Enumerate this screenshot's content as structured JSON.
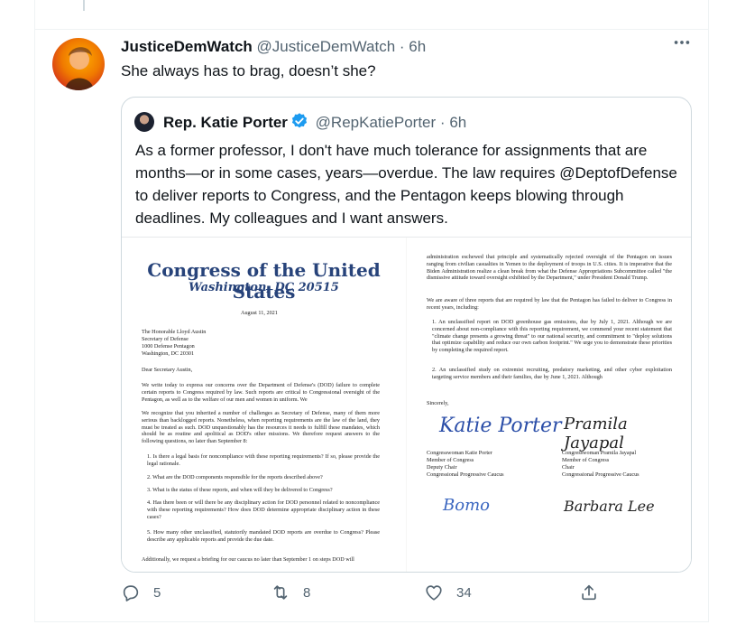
{
  "tweet": {
    "author_name": "JusticeDemWatch",
    "handle": "@JusticeDemWatch",
    "separator": "·",
    "time": "6h",
    "text": "She always has to brag, doesn’t she?",
    "more_icon": "more-horizontal-icon"
  },
  "quote": {
    "author_name": "Rep. Katie Porter",
    "handle": "@RepKatiePorter",
    "separator": "·",
    "time": "6h",
    "verified_icon": "verified-badge-icon",
    "verified_color": "#1d9bf0",
    "text": "As a former professor, I don't have much tolerance for assignments that are months—or in some cases, years—overdue. The law requires @DeptofDefense to deliver reports to Congress, and the Pentagon keeps blowing through deadlines. My colleagues and I want answers.",
    "letter": {
      "letterhead_title": "Congress of the United States",
      "letterhead_subtitle": "Washington, DC 20515",
      "date": "August 11, 2021",
      "address_1": "The Honorable Lloyd Austin",
      "address_2": "Secretary of Defense",
      "address_3": "1000 Defense Pentagon",
      "address_4": "Washington, DC 20301",
      "salutation": "Dear Secretary Austin,",
      "para_1": "We write today to express our concerns over the Department of Defense's (DOD) failure to complete certain reports to Congress required by law. Such reports are critical to Congressional oversight of the Pentagon, as well as to the welfare of our men and women in uniform. We",
      "para_2": "We recognize that you inherited a number of challenges as Secretary of Defense, many of them more serious than backlogged reports. Nonetheless, when reporting requirements are the law of the land, they must be treated as such. DOD unquestionably has the resources it needs to fulfill these mandates, which should be as routine and apolitical as DOD's other missions. We therefore request answers to the following questions, no later than September 8:",
      "q1": "1.  Is there a legal basis for noncompliance with these reporting requirements? If so, please provide the legal rationale.",
      "q2": "2.  What are the DOD components responsible for the reports described above?",
      "q3": "3.  What is the status of these reports, and when will they be delivered to Congress?",
      "q4": "4.  Has there been or will there be any disciplinary action for DOD personnel related to noncompliance with these reporting requirements? How does DOD determine appropriate disciplinary action in these cases?",
      "q5": "5.  How many other unclassified, statutorily mandated DOD reports are overdue to Congress? Please describe any applicable reports and provide the due date.",
      "left_footer": "Additionally, we request a briefing for our caucus no later than September 1 on steps DOD will",
      "right_para_1": "administration eschewed that principle and systematically rejected oversight of the Pentagon on issues ranging from civilian casualties in Yemen to the deployment of troops in U.S. cities. It is imperative that the Biden Administration realize a clean break from what the Defense Appropriations Subcommittee called \"the dismissive attitude toward oversight exhibited by the Department,\" under President Donald Trump.",
      "right_para_2": "We are aware of three reports that are required by law that the Pentagon has failed to deliver to Congress in recent years, including:",
      "right_item_1": "1.  An unclassified report on DOD greenhouse gas emissions, due by July 1, 2021. Although we are concerned about non-compliance with this reporting requirement, we commend your recent statement that \"climate change presents a growing threat\" to our national security, and commitment to \"deploy solutions that optimize capability and reduce our own carbon footprint.\" We urge you to demonstrate these priorities by completing the required report.",
      "right_item_2": "2.  An unclassified study on extremist recruiting, predatory marketing, and other cyber exploitation targeting service members and their families, due by June 1, 2021. Although",
      "sincerely": "Sincerely,",
      "sig_1_script": "Katie Porter",
      "sig_2_script": "Pramila Jayapal",
      "sig_3_script": "Bomo",
      "sig_4_script": "Barbara Lee",
      "signer_1": [
        "Congresswoman Katie Porter",
        "Member of Congress",
        "Deputy Chair",
        "Congressional Progressive Caucus"
      ],
      "signer_2": [
        "Congresswoman Pramila Jayapal",
        "Member of Congress",
        "Chair",
        "Congressional Progressive Caucus"
      ]
    }
  },
  "actions": {
    "reply_icon": "reply-icon",
    "reply_count": "5",
    "retweet_icon": "retweet-icon",
    "retweet_count": "8",
    "like_icon": "heart-icon",
    "like_count": "34",
    "share_icon": "share-icon"
  }
}
